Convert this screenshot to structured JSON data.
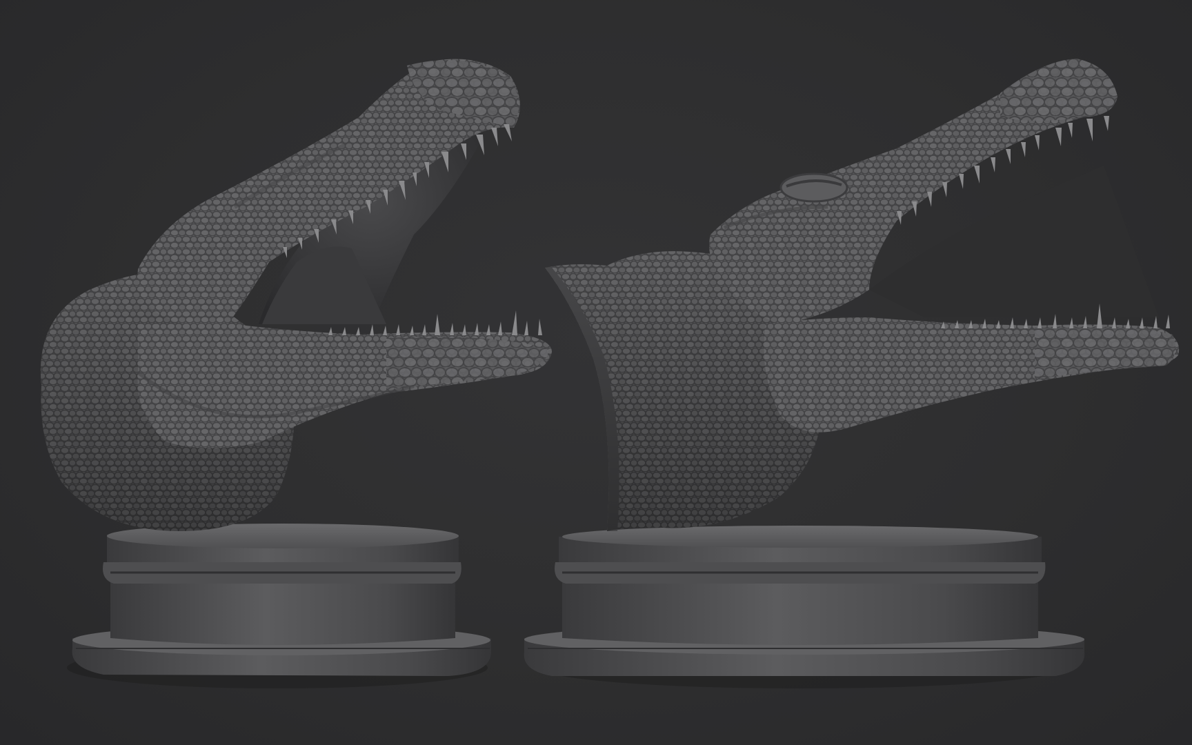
{
  "viewport": {
    "background_color": "#2e2e2f",
    "material_color": "#5a5a5c"
  },
  "models": [
    {
      "id": "left",
      "subject": "crocodile-head-bust",
      "view": "three-quarter-front"
    },
    {
      "id": "right",
      "subject": "crocodile-head-bust",
      "view": "side"
    }
  ]
}
